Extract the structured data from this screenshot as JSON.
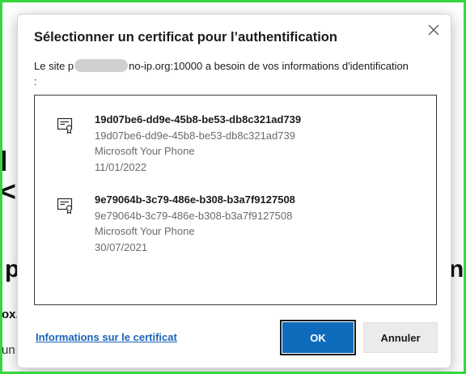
{
  "background": {
    "frag1": "l",
    "frag2": "<",
    "frag3": "p",
    "frag4": "nt",
    "frag5": "ox.",
    "frag6": "un"
  },
  "dialog": {
    "title": "Sélectionner un certificat pour l’authentification",
    "desc_prefix": "Le site p",
    "desc_suffix": "no-ip.org:10000 a besoin de vos informations d'identification :",
    "certificates": [
      {
        "name": "19d07be6-dd9e-45b8-be53-db8c321ad739",
        "id": "19d07be6-dd9e-45b8-be53-db8c321ad739",
        "issuer": "Microsoft Your Phone",
        "date": "11/01/2022"
      },
      {
        "name": "9e79064b-3c79-486e-b308-b3a7f9127508",
        "id": "9e79064b-3c79-486e-b308-b3a7f9127508",
        "issuer": "Microsoft Your Phone",
        "date": "30/07/2021"
      }
    ],
    "info_link": "Informations sur le certificat",
    "ok_label": "OK",
    "cancel_label": "Annuler"
  },
  "colors": {
    "accent": "#0f6cbd",
    "link": "#1a63b8",
    "frame": "#35d63f"
  },
  "icons": [
    "close-icon",
    "certificate-icon"
  ]
}
